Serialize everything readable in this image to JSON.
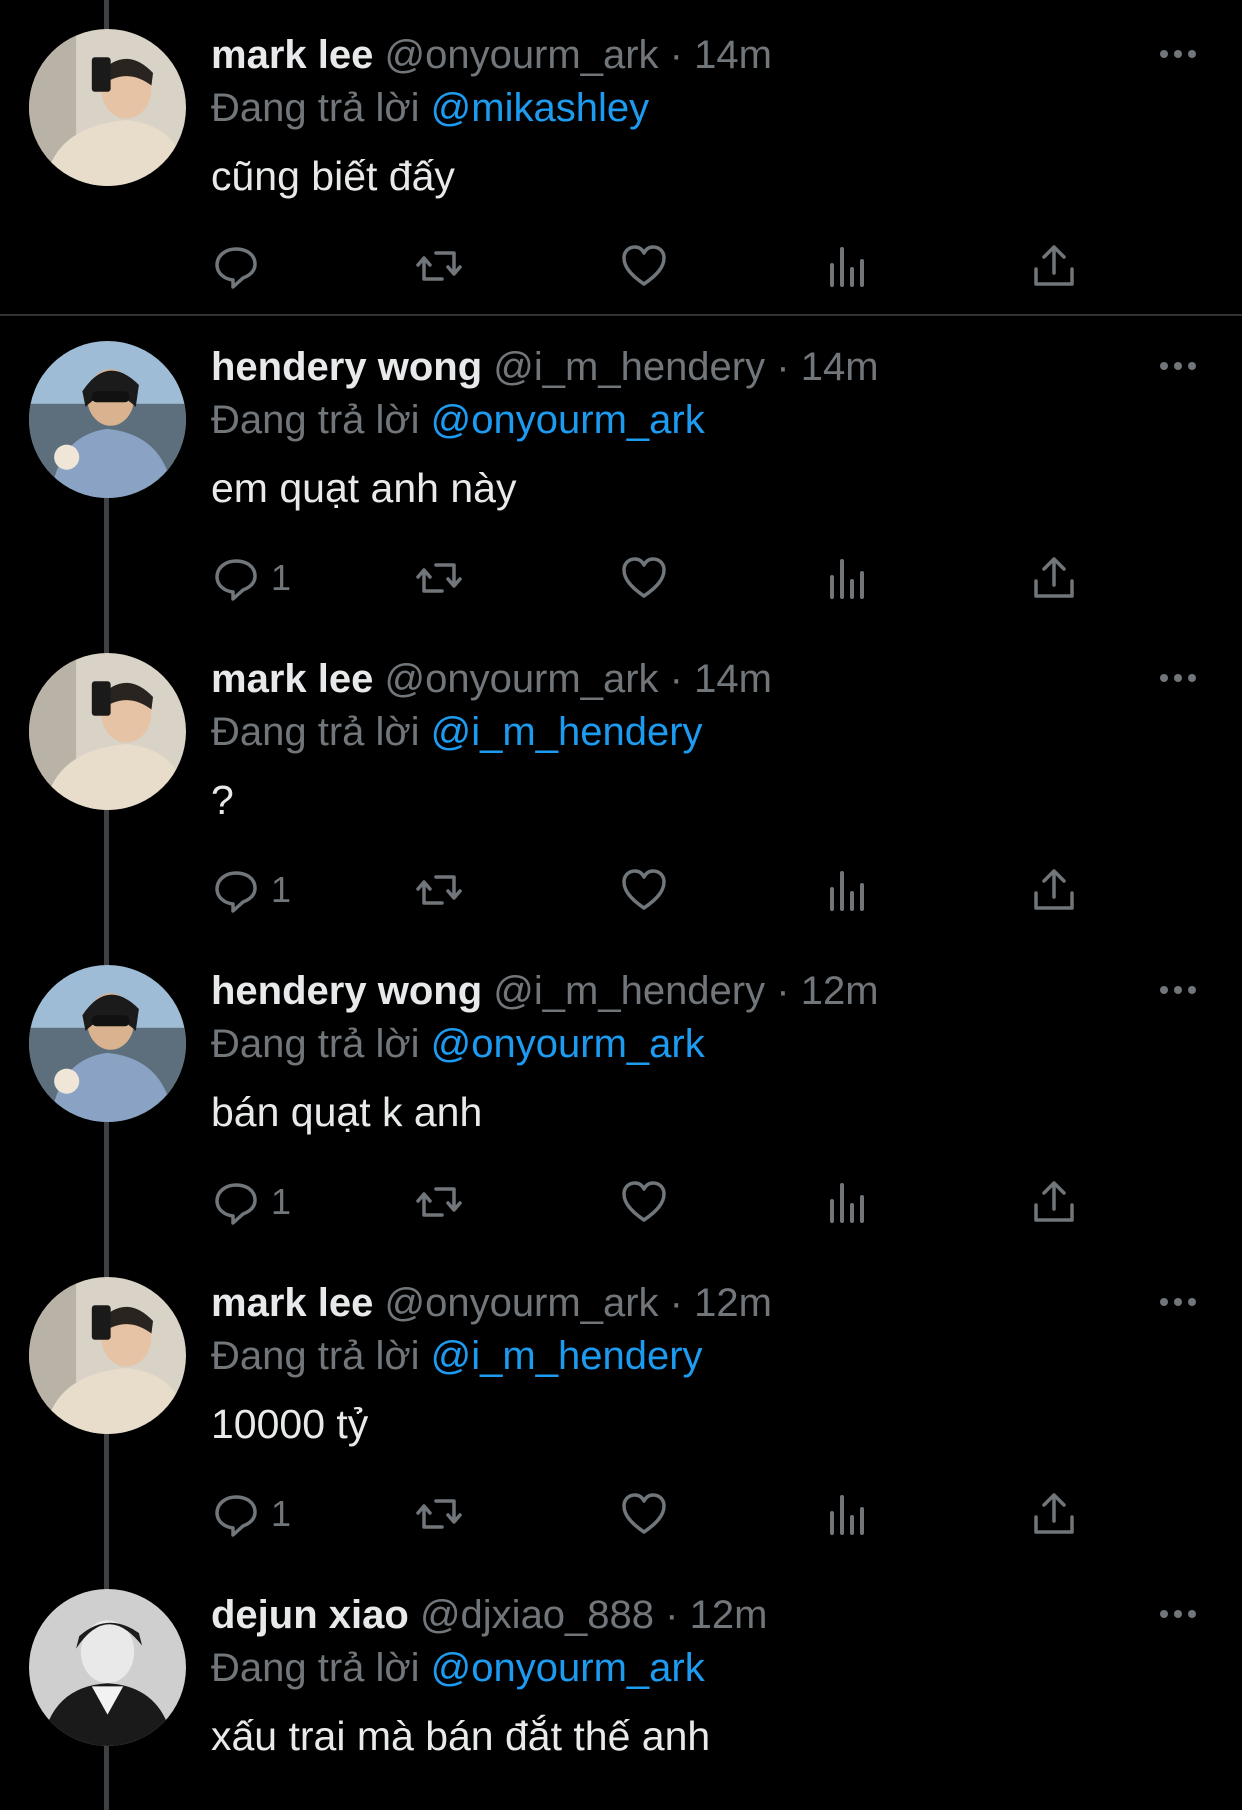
{
  "reply_prefix": "Đang trả lời",
  "tweets": [
    {
      "name": "mark lee",
      "handle": "@onyourm_ark",
      "dot": "·",
      "time": "14m",
      "reply_to": "@mikashley",
      "text": "cũng biết đấy",
      "reply_count": "",
      "avatar_icon": "avatar-mark-lee"
    },
    {
      "name": "hendery wong",
      "handle": "@i_m_hendery",
      "dot": "·",
      "time": "14m",
      "reply_to": "@onyourm_ark",
      "text": "em quạt anh này",
      "reply_count": "1",
      "avatar_icon": "avatar-hendery-wong"
    },
    {
      "name": "mark lee",
      "handle": "@onyourm_ark",
      "dot": "·",
      "time": "14m",
      "reply_to": "@i_m_hendery",
      "text": "?",
      "reply_count": "1",
      "avatar_icon": "avatar-mark-lee"
    },
    {
      "name": "hendery wong",
      "handle": "@i_m_hendery",
      "dot": "·",
      "time": "12m",
      "reply_to": "@onyourm_ark",
      "text": "bán quạt k anh",
      "reply_count": "1",
      "avatar_icon": "avatar-hendery-wong"
    },
    {
      "name": "mark lee",
      "handle": "@onyourm_ark",
      "dot": "·",
      "time": "12m",
      "reply_to": "@i_m_hendery",
      "text": "10000 tỷ",
      "reply_count": "1",
      "avatar_icon": "avatar-mark-lee"
    },
    {
      "name": "dejun xiao",
      "handle": "@djxiao_888",
      "dot": "·",
      "time": "12m",
      "reply_to": "@onyourm_ark",
      "text": "xấu trai mà bán đắt thế anh",
      "reply_count": "",
      "avatar_icon": "avatar-dejun-xiao"
    }
  ],
  "icons": [
    "reply-icon",
    "retweet-icon",
    "like-icon",
    "views-icon",
    "share-icon",
    "more-icon"
  ],
  "colors": {
    "background": "#000000",
    "text": "#e7e9ea",
    "muted": "#71767b",
    "mention": "#1d9bf0",
    "thread_line": "#3e4144",
    "separator": "#2f3336"
  }
}
